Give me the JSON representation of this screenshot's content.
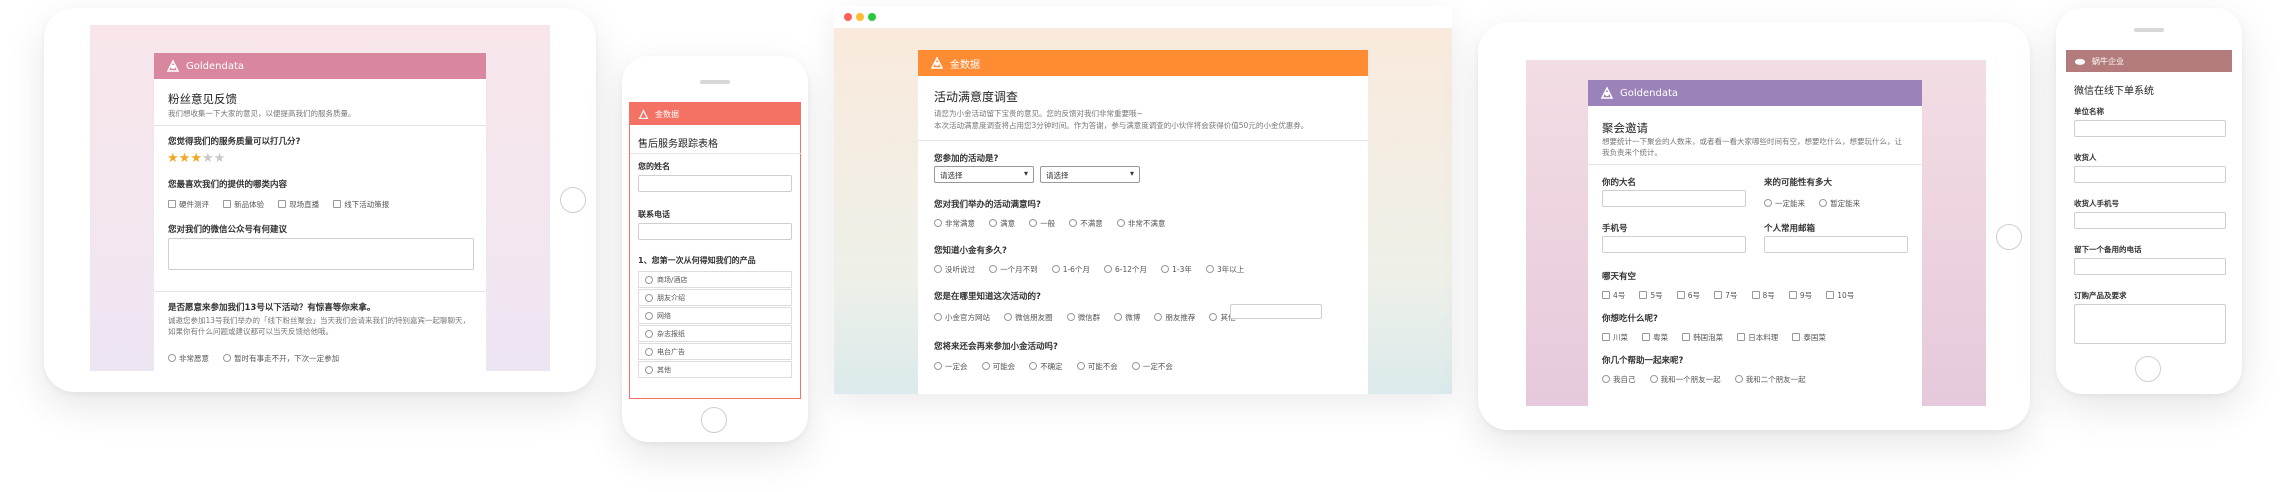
{
  "colors": {
    "pink_header": "#d9879f",
    "coral_header": "#f47264",
    "orange_header": "#ff8b33",
    "purple_header": "#9b82b8",
    "mauve_header": "#b37b7b"
  },
  "form1": {
    "brand": "Goldendata",
    "title": "粉丝意见反馈",
    "desc": "我们想收集一下大家的意见，以便提高我们的服务质量。",
    "q1": "您觉得我们的服务质量可以打几分?",
    "stars_filled": 3,
    "stars_total": 5,
    "q2": "您最喜欢我们的提供的哪类内容",
    "q2_options": [
      "硬件测评",
      "新品体验",
      "现场直播",
      "线下活动策报"
    ],
    "q3": "您对我们的微信公众号有何建议",
    "q4": "是否愿意来参加我们13号以下活动？有惊喜等你来拿。",
    "q4_desc": "诚邀您参加13号我们举办的「线下粉丝聚会」当天我们会请来我们的特别嘉宾一起聊聊天，如果你有什么问题或建议都可以当天反馈给他哦。",
    "q4_options": [
      "非常愿意",
      "暂时有事走不开，下次一定参加"
    ]
  },
  "form2": {
    "brand": "金数据",
    "title": "售后服务跟踪表格",
    "q1": "您的姓名",
    "q2": "联系电话",
    "q3": "1、您第一次从何得知我们的产品",
    "q3_options": [
      "商场/酒店",
      "朋友介绍",
      "网络",
      "杂志报纸",
      "电台广告",
      "其他"
    ]
  },
  "form3": {
    "brand": "金数据",
    "title": "活动满意度调查",
    "desc1": "请您为小金活动留下宝贵的意见。您的反馈对我们非常重要哦~",
    "desc2": "本次活动满意度调查将占用您3分钟时间。作为答谢，参与满意度调查的小伙伴将会获得价值50元的小金优惠券。",
    "q1": "您参加的活动是?",
    "select_placeholder": "请选择",
    "q2": "您对我们举办的活动满意吗?",
    "q2_options": [
      "非常满意",
      "满意",
      "一般",
      "不满意",
      "非常不满意"
    ],
    "q3": "您知道小金有多久?",
    "q3_options": [
      "没听说过",
      "一个月不到",
      "1-6个月",
      "6-12个月",
      "1-3年",
      "3年以上"
    ],
    "q4": "您是在哪里知道这次活动的?",
    "q4_options": [
      "小金官方网站",
      "微信朋友圈",
      "微信群",
      "微博",
      "朋友推荐",
      "其他"
    ],
    "q5": "您将来还会再来参加小金活动吗?",
    "q5_options": [
      "一定会",
      "可能会",
      "不确定",
      "可能不会",
      "一定不会"
    ]
  },
  "form4": {
    "brand": "Goldendata",
    "title": "聚会邀请",
    "desc": "想要统计一下聚会的人数来，或者看一看大家哪些时间有空，想要吃什么，想要玩什么，让我负责来个统计。",
    "q_name": "你的大名",
    "q_come": "来的可能性有多大",
    "q_come_options": [
      "一定能来",
      "暂定能来"
    ],
    "q_phone": "手机号",
    "q_email": "个人常用邮箱",
    "q_free": "哪天有空",
    "q_free_options": [
      "4号",
      "5号",
      "6号",
      "7号",
      "8号",
      "9号",
      "10号"
    ],
    "q_food": "你想吃什么呢?",
    "q_food_options": [
      "川菜",
      "粤菜",
      "韩国泡菜",
      "日本料理",
      "泰国菜"
    ],
    "q_help": "你几个帮助一起来呢?",
    "q_help_options": [
      "我自己",
      "我和一个朋友一起",
      "我和二个朋友一起"
    ]
  },
  "form5": {
    "brand": "蜗牛企业",
    "title": "微信在线下单系统",
    "q1": "单位名称",
    "q2": "收货人",
    "q3": "收货人手机号",
    "q4": "留下一个备用的电话",
    "q5": "订购产品及要求"
  }
}
